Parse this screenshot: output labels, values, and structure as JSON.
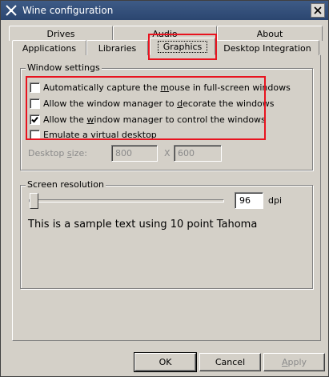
{
  "window": {
    "title": "Wine configuration",
    "icon": "wine-glass-icon"
  },
  "tabs": {
    "row1": [
      {
        "label": "Drives"
      },
      {
        "label": "Audio"
      },
      {
        "label": "About"
      }
    ],
    "row2": [
      {
        "label": "Applications"
      },
      {
        "label": "Libraries"
      },
      {
        "label": "Graphics",
        "selected": true
      },
      {
        "label": "Desktop Integration"
      }
    ]
  },
  "window_settings": {
    "group_label": "Window settings",
    "options": [
      {
        "pre": "Automatically capture the ",
        "key": "m",
        "post": "ouse in full-screen windows",
        "checked": false
      },
      {
        "pre": "Allow the window manager to ",
        "key": "d",
        "post": "ecorate the windows",
        "checked": false
      },
      {
        "pre": "Allow the ",
        "key": "w",
        "post": "indow manager to control the windows",
        "checked": true
      },
      {
        "pre": "",
        "key": "E",
        "post": "mulate a virtual desktop",
        "checked": false
      }
    ],
    "desktop_size": {
      "pre": "Desktop ",
      "key": "s",
      "post": "ize:",
      "width": "800",
      "separator": "X",
      "height": "600"
    }
  },
  "screen_resolution": {
    "group_label": "Screen resolution",
    "dpi_value": "96",
    "dpi_unit": "dpi",
    "slider_fraction": 0.0,
    "sample_text": "This is a sample text using 10 point Tahoma"
  },
  "buttons": {
    "ok": "OK",
    "cancel": "Cancel",
    "apply_key": "A",
    "apply_rest": "pply"
  },
  "colors": {
    "annotation": "#e8131f",
    "titlebar": "#2b4670"
  }
}
